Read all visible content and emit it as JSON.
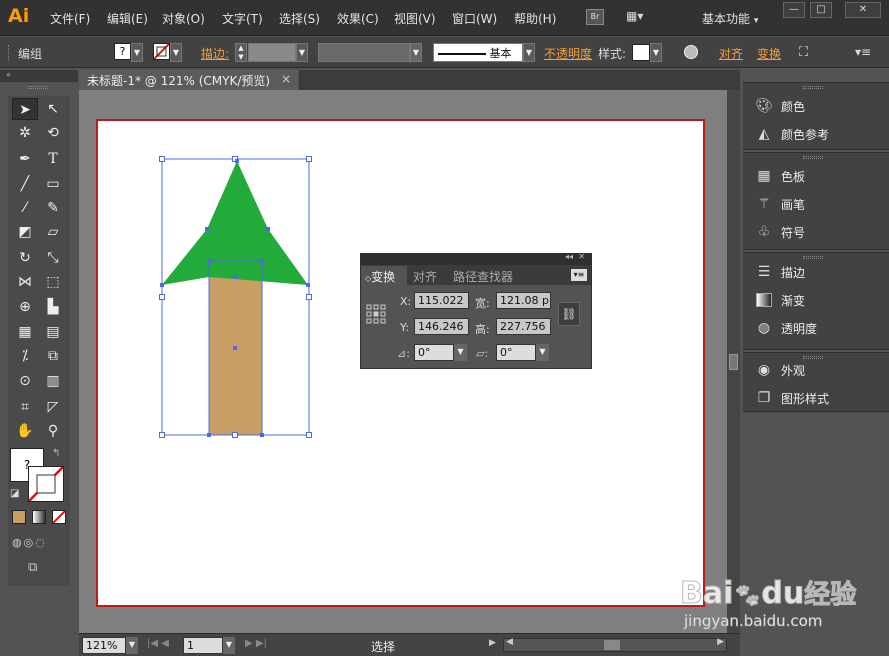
{
  "app": {
    "logo": "Ai",
    "menus": [
      "文件(F)",
      "编辑(E)",
      "对象(O)",
      "文字(T)",
      "选择(S)",
      "效果(C)",
      "视图(V)",
      "窗口(W)",
      "帮助(H)"
    ],
    "bridge_label": "Br",
    "workspace": "基本功能",
    "window_controls": [
      "—",
      "□",
      "✕"
    ]
  },
  "control": {
    "selection_type": "编组",
    "fill_swatch": "?",
    "stroke_label": "描边:",
    "brush_label": "基本",
    "opacity_label": "不透明度",
    "style_label": "样式:",
    "align_label": "对齐",
    "transform_label": "变换"
  },
  "document": {
    "tab_title": "未标题-1* @ 121% (CMYK/预览)",
    "zoom": "121%",
    "page": "1",
    "status": "选择"
  },
  "colors": {
    "tree_top": "#22aa3a",
    "trunk": "#c89e64",
    "selection": "#4a6ae8",
    "artboard_border": "#b81d1d",
    "accent": "#ff9a00"
  },
  "transform_panel": {
    "tabs": [
      "变换",
      "对齐",
      "路径查找器"
    ],
    "x_label": "X:",
    "x_value": "115.022",
    "w_label": "宽:",
    "w_value": "121.08 p",
    "y_label": "Y:",
    "y_value": "146.246",
    "h_label": "高:",
    "h_value": "227.756",
    "rotate_value": "0°",
    "shear_value": "0°"
  },
  "right_panel": {
    "groups": [
      [
        {
          "label": "颜色",
          "icon": "palette-icon"
        },
        {
          "label": "颜色参考",
          "icon": "color-guide-icon"
        }
      ],
      [
        {
          "label": "色板",
          "icon": "swatches-icon"
        },
        {
          "label": "画笔",
          "icon": "brush-icon"
        },
        {
          "label": "符号",
          "icon": "club-icon"
        }
      ],
      [
        {
          "label": "描边",
          "icon": "stroke-icon"
        },
        {
          "label": "渐变",
          "icon": "gradient-icon"
        },
        {
          "label": "透明度",
          "icon": "transparency-icon"
        }
      ],
      [
        {
          "label": "外观",
          "icon": "appearance-icon"
        },
        {
          "label": "图形样式",
          "icon": "graphic-styles-icon"
        }
      ]
    ]
  },
  "watermark": {
    "brand": "Bai",
    "brand2": "du",
    "cn": "经验",
    "url": "jingyan.baidu.com"
  }
}
